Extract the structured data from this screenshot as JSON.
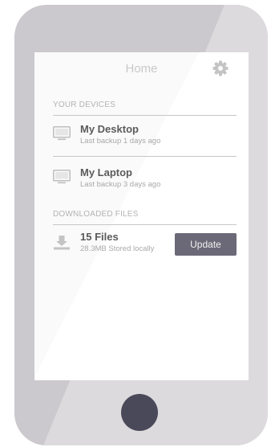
{
  "header": {
    "title": "Home",
    "settings_icon": "gear-icon"
  },
  "devices_section": {
    "label": "YOUR DEVICES",
    "items": [
      {
        "name": "My Desktop",
        "status": "Last backup 1 days ago",
        "icon": "monitor-icon"
      },
      {
        "name": "My Laptop",
        "status": "Last backup 3 days ago",
        "icon": "monitor-icon"
      }
    ]
  },
  "downloads_section": {
    "label": "DOWNLOADED FILES",
    "summary": "15 Files",
    "detail": "28.3MB Stored locally",
    "icon": "download-icon",
    "action_label": "Update"
  },
  "colors": {
    "phone_body": "#cbc9cd",
    "screen": "#fafafa",
    "accent_button": "#6b6977",
    "home_button": "#4a4959"
  }
}
